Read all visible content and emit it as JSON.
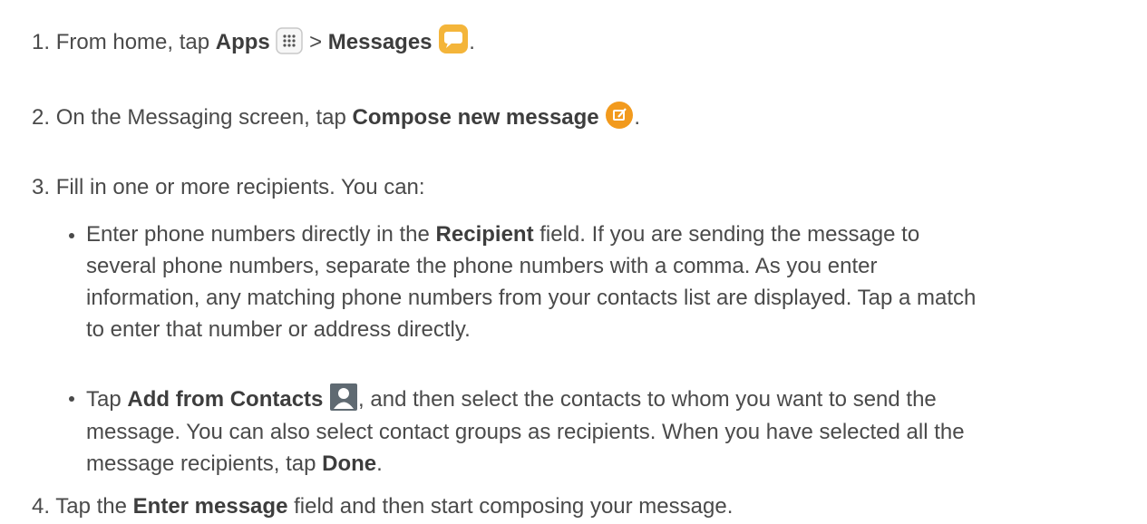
{
  "steps": {
    "s1": {
      "num": "1.",
      "pre": "From home, tap ",
      "b1": "Apps",
      "mid": " > ",
      "b2": "Messages",
      "post": "."
    },
    "s2": {
      "num": "2.",
      "pre": "On the Messaging screen, tap ",
      "b1": "Compose new message",
      "post": "."
    },
    "s3": {
      "num": "3.",
      "text": "Fill in one or more recipients. You can:"
    },
    "s4": {
      "num": "4.",
      "pre": "Tap the ",
      "b1": "Enter message",
      "post": " field and then start composing your message."
    }
  },
  "bullets": {
    "b1": {
      "l1_pre": "Enter phone numbers directly in the ",
      "l1_bold": "Recipient",
      "l1_post": " field. If you are sending the message to",
      "l2": "several phone numbers, separate the phone numbers with a comma. As you enter",
      "l3": "information, any matching phone numbers from your contacts list are displayed. Tap a match",
      "l4": "to enter that number or address directly."
    },
    "b2": {
      "l1_pre": "Tap ",
      "l1_bold": "Add from Contacts",
      "l1_post": ", and then select the contacts to whom you want to send the",
      "l2": "message. You can also select contact groups as recipients. When you have selected all the",
      "l3_pre": "message recipients, tap ",
      "l3_bold": "Done",
      "l3_post": "."
    }
  },
  "icons": {
    "apps": "apps-grid-icon",
    "messages": "messages-app-icon",
    "compose": "compose-message-icon",
    "contacts": "contacts-person-icon"
  },
  "colors": {
    "text": "#4a4a4a",
    "messages_orange": "#f4b53a",
    "compose_orange": "#f29a1d",
    "contacts_gray": "#5f6a72"
  }
}
